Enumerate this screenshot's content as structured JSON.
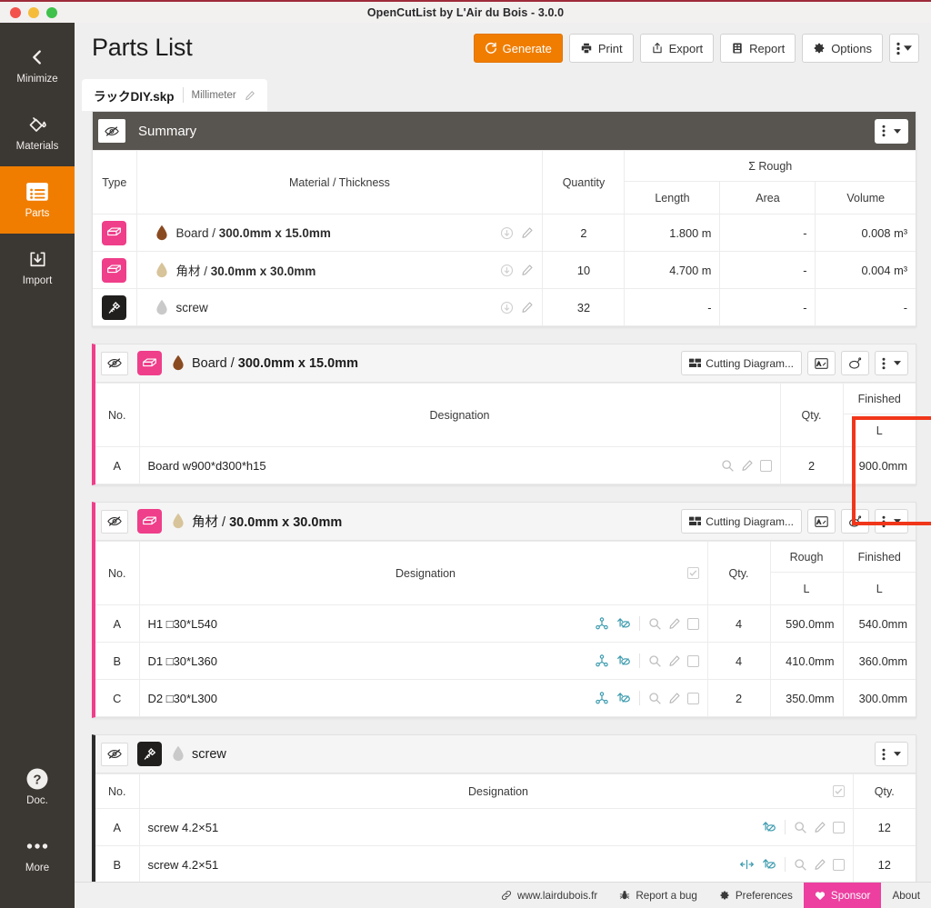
{
  "window": {
    "title": "OpenCutList by L'Air du Bois - 3.0.0",
    "traffic_close": "close-window",
    "traffic_min": "minimize-window",
    "traffic_max": "maximize-window"
  },
  "sidebar": {
    "items": [
      {
        "label": "Minimize",
        "icon": "chevron-left-icon",
        "active": false
      },
      {
        "label": "Materials",
        "icon": "paint-bucket-icon",
        "active": false
      },
      {
        "label": "Parts",
        "icon": "list-icon",
        "active": true
      },
      {
        "label": "Import",
        "icon": "import-icon",
        "active": false
      }
    ],
    "bottom_items": [
      {
        "label": "Doc.",
        "icon": "question-circle-icon"
      },
      {
        "label": "More",
        "icon": "ellipsis-icon"
      }
    ]
  },
  "page": {
    "title": "Parts List"
  },
  "toolbar": {
    "generate": "Generate",
    "print": "Print",
    "export": "Export",
    "report": "Report",
    "options": "Options",
    "kebab": "⋮"
  },
  "tab": {
    "filename": "ラックDIY.skp",
    "unit": "Millimeter"
  },
  "summary": {
    "title": "Summary",
    "columns": {
      "type": "Type",
      "material": "Material / Thickness",
      "quantity": "Quantity",
      "group": "Σ Rough",
      "length": "Length",
      "area": "Area",
      "volume": "Volume"
    },
    "rows": [
      {
        "type_icon": "board-icon",
        "badge": "pink",
        "drop": "#8a4a20",
        "name_plain": "Board / ",
        "name_bold": "300.0mm x 15.0mm",
        "quantity": "2",
        "length": "1.800 m",
        "area": "-",
        "volume": "0.008 m³"
      },
      {
        "type_icon": "board-icon",
        "badge": "pink",
        "drop": "#d8c49a",
        "name_plain": "角材 / ",
        "name_bold": "30.0mm x 30.0mm",
        "quantity": "10",
        "length": "4.700 m",
        "area": "-",
        "volume": "0.004 m³"
      },
      {
        "type_icon": "screw-icon",
        "badge": "dark",
        "drop": "#c9c9c9",
        "name_plain": "screw",
        "name_bold": "",
        "quantity": "32",
        "length": "-",
        "area": "-",
        "volume": "-"
      }
    ]
  },
  "groups": [
    {
      "id": "board",
      "stripe": "pink",
      "badge": "pink",
      "drop_color": "#8a4a20",
      "title_plain": "Board / ",
      "title_bold": "300.0mm x 15.0mm",
      "buttons": {
        "cutting_diagram": "Cutting Diagram...",
        "labels": "labels-icon",
        "tags": "tags-icon",
        "kebab": "⋮"
      },
      "columns": {
        "no": "No.",
        "designation": "Designation",
        "qty": "Qty.",
        "rough": "",
        "finished": "Finished",
        "rough_l": "",
        "finished_l": "L"
      },
      "has_rough": false,
      "rows": [
        {
          "no": "A",
          "designation": "Board w900*d300*h15",
          "qty": "2",
          "rough": "",
          "finished": "900.0mm",
          "row_icons": []
        }
      ]
    },
    {
      "id": "kakuzai",
      "stripe": "pink",
      "badge": "pink",
      "drop_color": "#d8c49a",
      "title_plain": "角材 / ",
      "title_bold": "30.0mm x 30.0mm",
      "buttons": {
        "cutting_diagram": "Cutting Diagram...",
        "labels": "labels-icon",
        "tags": "tags-icon",
        "kebab": "⋮"
      },
      "columns": {
        "no": "No.",
        "designation": "Designation",
        "qty": "Qty.",
        "rough": "Rough",
        "finished": "Finished",
        "rough_l": "L",
        "finished_l": "L"
      },
      "has_rough": true,
      "rows": [
        {
          "no": "A",
          "designation": "H1 □30*L540",
          "qty": "4",
          "rough": "590.0mm",
          "finished": "540.0mm",
          "row_icons": [
            "axes-icon",
            "flip-icon"
          ]
        },
        {
          "no": "B",
          "designation": "D1 □30*L360",
          "qty": "4",
          "rough": "410.0mm",
          "finished": "360.0mm",
          "row_icons": [
            "axes-icon",
            "flip-icon"
          ]
        },
        {
          "no": "C",
          "designation": "D2 □30*L300",
          "qty": "2",
          "rough": "350.0mm",
          "finished": "300.0mm",
          "row_icons": [
            "axes-icon",
            "flip-icon"
          ]
        }
      ]
    },
    {
      "id": "screw",
      "stripe": "dark",
      "badge": "dark",
      "drop_color": "#c9c9c9",
      "title_plain": "screw",
      "title_bold": "",
      "buttons": {
        "cutting_diagram": "",
        "labels": "",
        "tags": "",
        "kebab": "⋮"
      },
      "columns": {
        "no": "No.",
        "designation": "Designation",
        "qty": "Qty."
      },
      "has_rough": false,
      "rows": [
        {
          "no": "A",
          "designation": "screw 4.2×51",
          "qty": "12",
          "row_icons": [
            "flip-icon"
          ]
        },
        {
          "no": "B",
          "designation": "screw 4.2×51",
          "qty": "12",
          "row_icons": [
            "mirror-icon",
            "flip-icon"
          ]
        }
      ]
    }
  ],
  "footer": {
    "items": [
      {
        "label": "www.lairdubois.fr",
        "icon": "link-icon",
        "highlight": false
      },
      {
        "label": "Report a bug",
        "icon": "bug-icon",
        "highlight": false
      },
      {
        "label": "Preferences",
        "icon": "gear-icon",
        "highlight": false
      },
      {
        "label": "Sponsor",
        "icon": "heart-icon",
        "highlight": true
      },
      {
        "label": "About",
        "icon": "",
        "highlight": false
      }
    ]
  },
  "annotation": {
    "red_box": "highlight-qty-finished-columns",
    "color": "#f0361a"
  }
}
